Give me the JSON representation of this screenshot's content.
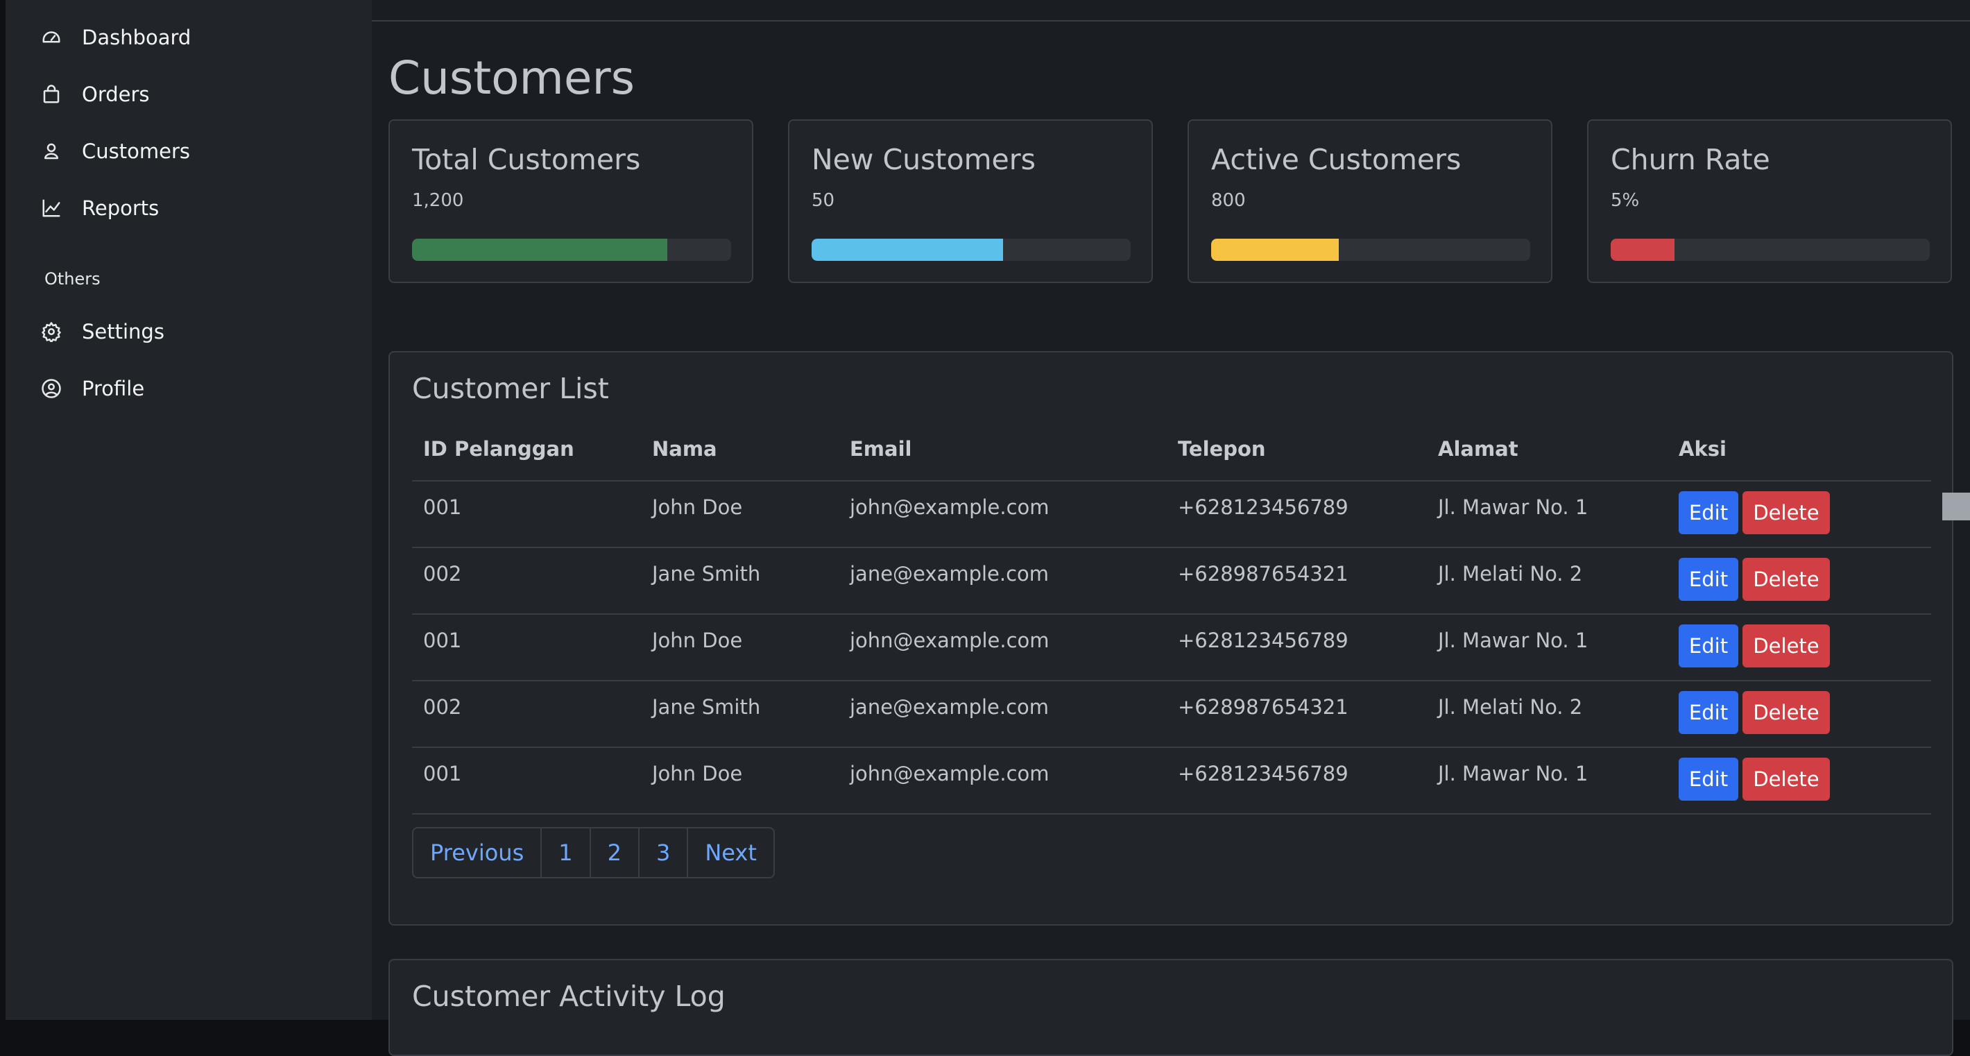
{
  "sidebar": {
    "items": [
      {
        "label": "Dashboard",
        "icon": "speedometer-icon"
      },
      {
        "label": "Orders",
        "icon": "bag-icon"
      },
      {
        "label": "Customers",
        "icon": "person-icon"
      },
      {
        "label": "Reports",
        "icon": "chart-line-icon"
      }
    ],
    "section_label": "Others",
    "other_items": [
      {
        "label": "Settings",
        "icon": "gear-icon"
      },
      {
        "label": "Profile",
        "icon": "user-circle-icon"
      }
    ]
  },
  "main": {
    "title": "Customers",
    "stats": [
      {
        "title": "Total Customers",
        "value": "1,200",
        "progress": 0.8,
        "color": "#3a7d4f"
      },
      {
        "title": "New Customers",
        "value": "50",
        "progress": 0.6,
        "color": "#5bc0ea"
      },
      {
        "title": "Active Customers",
        "value": "800",
        "progress": 0.4,
        "color": "#f5c242"
      },
      {
        "title": "Churn Rate",
        "value": "5%",
        "progress": 0.2,
        "color": "#cf4247"
      }
    ],
    "customer_list": {
      "title": "Customer List",
      "columns": [
        "ID Pelanggan",
        "Nama",
        "Email",
        "Telepon",
        "Alamat",
        "Aksi"
      ],
      "rows": [
        [
          "001",
          "John Doe",
          "john@example.com",
          "+628123456789",
          "Jl. Mawar No. 1"
        ],
        [
          "002",
          "Jane Smith",
          "jane@example.com",
          "+628987654321",
          "Jl. Melati No. 2"
        ],
        [
          "001",
          "John Doe",
          "john@example.com",
          "+628123456789",
          "Jl. Mawar No. 1"
        ],
        [
          "002",
          "Jane Smith",
          "jane@example.com",
          "+628987654321",
          "Jl. Melati No. 2"
        ],
        [
          "001",
          "John Doe",
          "john@example.com",
          "+628123456789",
          "Jl. Mawar No. 1"
        ]
      ],
      "edit_label": "Edit",
      "delete_label": "Delete",
      "pagination": [
        "Previous",
        "1",
        "2",
        "3",
        "Next"
      ]
    },
    "activity_log": {
      "title": "Customer Activity Log"
    }
  }
}
